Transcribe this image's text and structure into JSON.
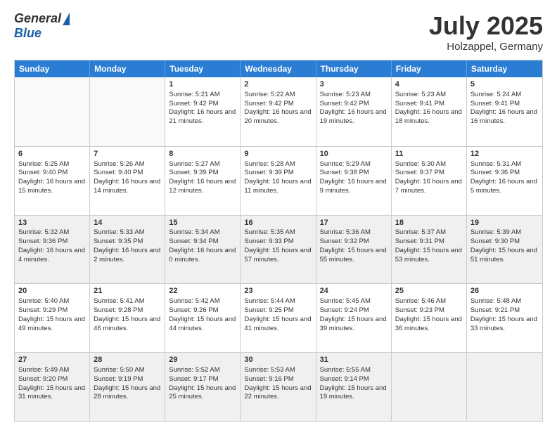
{
  "header": {
    "logo_general": "General",
    "logo_blue": "Blue",
    "month_title": "July 2025",
    "location": "Holzappel, Germany"
  },
  "days_of_week": [
    "Sunday",
    "Monday",
    "Tuesday",
    "Wednesday",
    "Thursday",
    "Friday",
    "Saturday"
  ],
  "weeks": [
    [
      {
        "day": "",
        "empty": true
      },
      {
        "day": "",
        "empty": true
      },
      {
        "day": "1",
        "sunrise": "Sunrise: 5:21 AM",
        "sunset": "Sunset: 9:42 PM",
        "daylight": "Daylight: 16 hours and 21 minutes."
      },
      {
        "day": "2",
        "sunrise": "Sunrise: 5:22 AM",
        "sunset": "Sunset: 9:42 PM",
        "daylight": "Daylight: 16 hours and 20 minutes."
      },
      {
        "day": "3",
        "sunrise": "Sunrise: 5:23 AM",
        "sunset": "Sunset: 9:42 PM",
        "daylight": "Daylight: 16 hours and 19 minutes."
      },
      {
        "day": "4",
        "sunrise": "Sunrise: 5:23 AM",
        "sunset": "Sunset: 9:41 PM",
        "daylight": "Daylight: 16 hours and 18 minutes."
      },
      {
        "day": "5",
        "sunrise": "Sunrise: 5:24 AM",
        "sunset": "Sunset: 9:41 PM",
        "daylight": "Daylight: 16 hours and 16 minutes."
      }
    ],
    [
      {
        "day": "6",
        "sunrise": "Sunrise: 5:25 AM",
        "sunset": "Sunset: 9:40 PM",
        "daylight": "Daylight: 16 hours and 15 minutes."
      },
      {
        "day": "7",
        "sunrise": "Sunrise: 5:26 AM",
        "sunset": "Sunset: 9:40 PM",
        "daylight": "Daylight: 16 hours and 14 minutes."
      },
      {
        "day": "8",
        "sunrise": "Sunrise: 5:27 AM",
        "sunset": "Sunset: 9:39 PM",
        "daylight": "Daylight: 16 hours and 12 minutes."
      },
      {
        "day": "9",
        "sunrise": "Sunrise: 5:28 AM",
        "sunset": "Sunset: 9:39 PM",
        "daylight": "Daylight: 16 hours and 11 minutes."
      },
      {
        "day": "10",
        "sunrise": "Sunrise: 5:29 AM",
        "sunset": "Sunset: 9:38 PM",
        "daylight": "Daylight: 16 hours and 9 minutes."
      },
      {
        "day": "11",
        "sunrise": "Sunrise: 5:30 AM",
        "sunset": "Sunset: 9:37 PM",
        "daylight": "Daylight: 16 hours and 7 minutes."
      },
      {
        "day": "12",
        "sunrise": "Sunrise: 5:31 AM",
        "sunset": "Sunset: 9:36 PM",
        "daylight": "Daylight: 16 hours and 5 minutes."
      }
    ],
    [
      {
        "day": "13",
        "sunrise": "Sunrise: 5:32 AM",
        "sunset": "Sunset: 9:36 PM",
        "daylight": "Daylight: 16 hours and 4 minutes.",
        "shaded": true
      },
      {
        "day": "14",
        "sunrise": "Sunrise: 5:33 AM",
        "sunset": "Sunset: 9:35 PM",
        "daylight": "Daylight: 16 hours and 2 minutes.",
        "shaded": true
      },
      {
        "day": "15",
        "sunrise": "Sunrise: 5:34 AM",
        "sunset": "Sunset: 9:34 PM",
        "daylight": "Daylight: 16 hours and 0 minutes.",
        "shaded": true
      },
      {
        "day": "16",
        "sunrise": "Sunrise: 5:35 AM",
        "sunset": "Sunset: 9:33 PM",
        "daylight": "Daylight: 15 hours and 57 minutes.",
        "shaded": true
      },
      {
        "day": "17",
        "sunrise": "Sunrise: 5:36 AM",
        "sunset": "Sunset: 9:32 PM",
        "daylight": "Daylight: 15 hours and 55 minutes.",
        "shaded": true
      },
      {
        "day": "18",
        "sunrise": "Sunrise: 5:37 AM",
        "sunset": "Sunset: 9:31 PM",
        "daylight": "Daylight: 15 hours and 53 minutes.",
        "shaded": true
      },
      {
        "day": "19",
        "sunrise": "Sunrise: 5:39 AM",
        "sunset": "Sunset: 9:30 PM",
        "daylight": "Daylight: 15 hours and 51 minutes.",
        "shaded": true
      }
    ],
    [
      {
        "day": "20",
        "sunrise": "Sunrise: 5:40 AM",
        "sunset": "Sunset: 9:29 PM",
        "daylight": "Daylight: 15 hours and 49 minutes."
      },
      {
        "day": "21",
        "sunrise": "Sunrise: 5:41 AM",
        "sunset": "Sunset: 9:28 PM",
        "daylight": "Daylight: 15 hours and 46 minutes."
      },
      {
        "day": "22",
        "sunrise": "Sunrise: 5:42 AM",
        "sunset": "Sunset: 9:26 PM",
        "daylight": "Daylight: 15 hours and 44 minutes."
      },
      {
        "day": "23",
        "sunrise": "Sunrise: 5:44 AM",
        "sunset": "Sunset: 9:25 PM",
        "daylight": "Daylight: 15 hours and 41 minutes."
      },
      {
        "day": "24",
        "sunrise": "Sunrise: 5:45 AM",
        "sunset": "Sunset: 9:24 PM",
        "daylight": "Daylight: 15 hours and 39 minutes."
      },
      {
        "day": "25",
        "sunrise": "Sunrise: 5:46 AM",
        "sunset": "Sunset: 9:23 PM",
        "daylight": "Daylight: 15 hours and 36 minutes."
      },
      {
        "day": "26",
        "sunrise": "Sunrise: 5:48 AM",
        "sunset": "Sunset: 9:21 PM",
        "daylight": "Daylight: 15 hours and 33 minutes."
      }
    ],
    [
      {
        "day": "27",
        "sunrise": "Sunrise: 5:49 AM",
        "sunset": "Sunset: 9:20 PM",
        "daylight": "Daylight: 15 hours and 31 minutes.",
        "shaded": true
      },
      {
        "day": "28",
        "sunrise": "Sunrise: 5:50 AM",
        "sunset": "Sunset: 9:19 PM",
        "daylight": "Daylight: 15 hours and 28 minutes.",
        "shaded": true
      },
      {
        "day": "29",
        "sunrise": "Sunrise: 5:52 AM",
        "sunset": "Sunset: 9:17 PM",
        "daylight": "Daylight: 15 hours and 25 minutes.",
        "shaded": true
      },
      {
        "day": "30",
        "sunrise": "Sunrise: 5:53 AM",
        "sunset": "Sunset: 9:16 PM",
        "daylight": "Daylight: 15 hours and 22 minutes.",
        "shaded": true
      },
      {
        "day": "31",
        "sunrise": "Sunrise: 5:55 AM",
        "sunset": "Sunset: 9:14 PM",
        "daylight": "Daylight: 15 hours and 19 minutes.",
        "shaded": true
      },
      {
        "day": "",
        "empty": true,
        "shaded": true
      },
      {
        "day": "",
        "empty": true,
        "shaded": true
      }
    ]
  ]
}
